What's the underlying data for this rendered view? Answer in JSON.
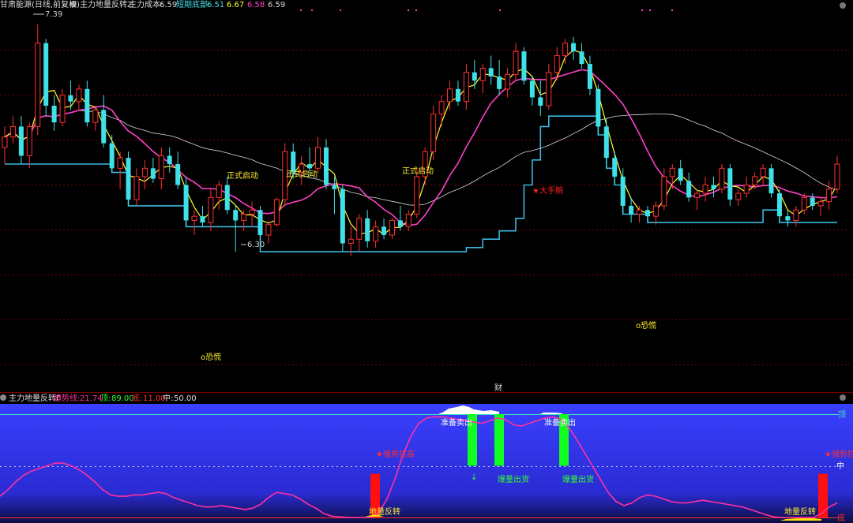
{
  "colors": {
    "candle_up": "#ff3030",
    "candle_down": "#40e0e8",
    "ma_fast": "#ffff30",
    "ma_mid": "#ff40c8",
    "ma_slow": "#d8d8d8",
    "support": "#38b8e0",
    "signal": "#ff30a0",
    "grid": "#7a0000",
    "bg_bottom": "#2b2cd8"
  },
  "top": {
    "stock": "甘肃能源(日线,前复权)",
    "indicator": "主力地量反转Z",
    "cost_label": "主力成本:",
    "cost_value": "6.59",
    "bottom_label": "短期底部:",
    "v1": "6.51",
    "v2": "6.67",
    "v3": "6.58",
    "v4": "6.59",
    "high_label": "7.39",
    "low_label": "6.30",
    "signal_start": "正式启动",
    "signal_big": "★大手腕",
    "panic": "o恐慌",
    "finance": "财"
  },
  "bottom": {
    "name": "主力地量反转F",
    "trend_label": "趋势线:",
    "trend_value": "21.74",
    "top_label": "顶:",
    "top_value": "89.00",
    "bot_label": "底:",
    "bot_value": "11.00",
    "mid_label": "中:",
    "mid_value": "50.00",
    "axis_top": "顶",
    "axis_mid": "中",
    "axis_bot": "底",
    "sell": "准备卖出",
    "reversal": "地量反转",
    "breakout": "爆量出货",
    "master": "★强势拉高"
  },
  "chart_data": [
    {
      "type": "candlestick",
      "title": "",
      "ylim": [
        6.1,
        7.45
      ],
      "high_mark": 7.39,
      "low_mark": 6.3,
      "ohlc": [
        [
          6.8,
          6.9,
          6.72,
          6.85
        ],
        [
          6.85,
          6.95,
          6.82,
          6.9
        ],
        [
          6.9,
          6.95,
          6.72,
          6.76
        ],
        [
          6.76,
          6.92,
          6.7,
          6.9
        ],
        [
          6.9,
          7.39,
          6.86,
          7.3
        ],
        [
          7.3,
          7.32,
          6.95,
          7.0
        ],
        [
          7.0,
          7.05,
          6.88,
          6.92
        ],
        [
          6.92,
          7.08,
          6.9,
          7.05
        ],
        [
          7.05,
          7.12,
          6.98,
          7.02
        ],
        [
          7.02,
          7.1,
          6.98,
          7.08
        ],
        [
          7.08,
          7.12,
          6.9,
          6.92
        ],
        [
          6.92,
          7.0,
          6.88,
          6.98
        ],
        [
          6.98,
          7.05,
          6.8,
          6.82
        ],
        [
          6.82,
          6.86,
          6.68,
          6.7
        ],
        [
          6.7,
          6.78,
          6.6,
          6.75
        ],
        [
          6.75,
          6.78,
          6.52,
          6.55
        ],
        [
          6.55,
          6.7,
          6.52,
          6.66
        ],
        [
          6.66,
          6.74,
          6.6,
          6.7
        ],
        [
          6.7,
          6.75,
          6.63,
          6.65
        ],
        [
          6.65,
          6.8,
          6.6,
          6.76
        ],
        [
          6.76,
          6.8,
          6.68,
          6.72
        ],
        [
          6.72,
          6.78,
          6.6,
          6.62
        ],
        [
          6.62,
          6.66,
          6.42,
          6.45
        ],
        [
          6.45,
          6.5,
          6.38,
          6.47
        ],
        [
          6.47,
          6.52,
          6.42,
          6.44
        ],
        [
          6.44,
          6.6,
          6.4,
          6.56
        ],
        [
          6.56,
          6.64,
          6.5,
          6.62
        ],
        [
          6.62,
          6.66,
          6.48,
          6.5
        ],
        [
          6.5,
          6.52,
          6.3,
          6.45
        ],
        [
          6.45,
          6.5,
          6.4,
          6.48
        ],
        [
          6.48,
          6.54,
          6.42,
          6.5
        ],
        [
          6.5,
          6.52,
          6.35,
          6.38
        ],
        [
          6.38,
          6.45,
          6.34,
          6.43
        ],
        [
          6.43,
          6.56,
          6.42,
          6.55
        ],
        [
          6.55,
          6.82,
          6.52,
          6.78
        ],
        [
          6.78,
          6.82,
          6.65,
          6.68
        ],
        [
          6.68,
          6.76,
          6.62,
          6.72
        ],
        [
          6.72,
          6.8,
          6.66,
          6.7
        ],
        [
          6.7,
          6.85,
          6.68,
          6.8
        ],
        [
          6.8,
          6.84,
          6.6,
          6.62
        ],
        [
          6.62,
          6.66,
          6.48,
          6.6
        ],
        [
          6.6,
          6.62,
          6.3,
          6.34
        ],
        [
          6.34,
          6.42,
          6.28,
          6.36
        ],
        [
          6.36,
          6.48,
          6.3,
          6.46
        ],
        [
          6.46,
          6.5,
          6.32,
          6.35
        ],
        [
          6.35,
          6.45,
          6.32,
          6.42
        ],
        [
          6.42,
          6.46,
          6.36,
          6.38
        ],
        [
          6.38,
          6.46,
          6.36,
          6.45
        ],
        [
          6.45,
          6.52,
          6.4,
          6.42
        ],
        [
          6.42,
          6.5,
          6.4,
          6.48
        ],
        [
          6.48,
          6.7,
          6.46,
          6.66
        ],
        [
          6.66,
          6.8,
          6.62,
          6.78
        ],
        [
          6.78,
          7.0,
          6.74,
          6.96
        ],
        [
          6.96,
          7.05,
          6.9,
          7.02
        ],
        [
          7.02,
          7.12,
          6.98,
          7.08
        ],
        [
          7.08,
          7.12,
          7.0,
          7.02
        ],
        [
          7.02,
          7.2,
          6.98,
          7.16
        ],
        [
          7.16,
          7.22,
          7.08,
          7.12
        ],
        [
          7.12,
          7.2,
          7.06,
          7.18
        ],
        [
          7.18,
          7.24,
          7.1,
          7.14
        ],
        [
          7.14,
          7.22,
          7.05,
          7.08
        ],
        [
          7.08,
          7.18,
          7.04,
          7.15
        ],
        [
          7.15,
          7.3,
          7.12,
          7.26
        ],
        [
          7.26,
          7.28,
          7.1,
          7.12
        ],
        [
          7.12,
          7.14,
          7.0,
          7.04
        ],
        [
          7.04,
          7.12,
          6.95,
          7.0
        ],
        [
          7.0,
          7.2,
          6.98,
          7.16
        ],
        [
          7.16,
          7.28,
          7.12,
          7.24
        ],
        [
          7.24,
          7.32,
          7.2,
          7.3
        ],
        [
          7.3,
          7.33,
          7.22,
          7.26
        ],
        [
          7.26,
          7.3,
          7.18,
          7.2
        ],
        [
          7.2,
          7.24,
          7.05,
          7.08
        ],
        [
          7.08,
          7.1,
          6.86,
          6.9
        ],
        [
          6.9,
          6.94,
          6.7,
          6.75
        ],
        [
          6.75,
          6.78,
          6.62,
          6.66
        ],
        [
          6.66,
          6.7,
          6.48,
          6.52
        ],
        [
          6.52,
          6.56,
          6.44,
          6.48
        ],
        [
          6.48,
          6.52,
          6.44,
          6.5
        ],
        [
          6.5,
          6.52,
          6.44,
          6.47
        ],
        [
          6.47,
          6.54,
          6.43,
          6.52
        ],
        [
          6.52,
          6.7,
          6.5,
          6.66
        ],
        [
          6.66,
          6.72,
          6.6,
          6.7
        ],
        [
          6.7,
          6.74,
          6.62,
          6.64
        ],
        [
          6.64,
          6.68,
          6.54,
          6.56
        ],
        [
          6.56,
          6.6,
          6.5,
          6.58
        ],
        [
          6.58,
          6.66,
          6.54,
          6.62
        ],
        [
          6.62,
          6.66,
          6.56,
          6.6
        ],
        [
          6.6,
          6.72,
          6.58,
          6.7
        ],
        [
          6.7,
          6.72,
          6.52,
          6.55
        ],
        [
          6.55,
          6.6,
          6.52,
          6.58
        ],
        [
          6.58,
          6.66,
          6.56,
          6.62
        ],
        [
          6.62,
          6.68,
          6.6,
          6.66
        ],
        [
          6.66,
          6.72,
          6.62,
          6.7
        ],
        [
          6.7,
          6.72,
          6.56,
          6.58
        ],
        [
          6.58,
          6.6,
          6.44,
          6.47
        ],
        [
          6.47,
          6.5,
          6.42,
          6.45
        ],
        [
          6.45,
          6.52,
          6.42,
          6.5
        ],
        [
          6.5,
          6.58,
          6.48,
          6.56
        ],
        [
          6.56,
          6.58,
          6.5,
          6.52
        ],
        [
          6.52,
          6.56,
          6.47,
          6.54
        ],
        [
          6.54,
          6.64,
          6.5,
          6.6
        ],
        [
          6.6,
          6.76,
          6.58,
          6.72
        ]
      ]
    },
    {
      "type": "line",
      "title": "",
      "ylim": [
        11,
        89
      ],
      "x": [
        0,
        10,
        20,
        30,
        40,
        50,
        60,
        70,
        80,
        90,
        100,
        110,
        120,
        130,
        140,
        150,
        160,
        170,
        180,
        190,
        200,
        210,
        220,
        230,
        240,
        250,
        260,
        270,
        280,
        290,
        300,
        310,
        320,
        330,
        340,
        350,
        360,
        370,
        380,
        390,
        400,
        410,
        420,
        430,
        440,
        450,
        460,
        470,
        480,
        490,
        500,
        510,
        520,
        530,
        540,
        550,
        560,
        570,
        580,
        590,
        600,
        610,
        620,
        630,
        640,
        650,
        660,
        670,
        680,
        690,
        700,
        710,
        720,
        730,
        740,
        750,
        760,
        770,
        780,
        790,
        800,
        810,
        820,
        830,
        840,
        850,
        860,
        870,
        880,
        890,
        900,
        910,
        920,
        930,
        940,
        950,
        960,
        970,
        980,
        990,
        1000,
        1010,
        1020,
        1030,
        1040,
        1050,
        1060
      ],
      "series": [
        {
          "values": [
            27,
            32,
            38,
            43,
            46,
            48,
            50,
            52,
            52,
            50,
            47,
            43,
            38,
            32,
            28,
            27,
            27,
            28,
            28,
            29,
            30,
            29,
            26,
            24,
            22,
            20,
            19,
            19,
            20,
            19,
            18,
            17,
            18,
            21,
            26,
            30,
            29,
            28,
            25,
            21,
            18,
            14,
            12,
            11.5,
            11,
            11,
            11,
            11,
            15,
            25,
            40,
            58,
            72,
            82,
            86,
            87,
            87,
            86,
            85,
            84,
            83,
            82,
            84,
            86,
            85,
            81,
            80,
            82,
            84,
            86,
            87,
            85,
            79,
            70,
            60,
            50,
            40,
            30,
            23,
            20,
            22,
            26,
            28,
            27,
            25,
            23,
            22,
            22,
            23,
            24,
            23,
            22,
            21,
            20,
            19,
            17,
            15,
            13,
            11.5,
            11,
            11,
            11,
            11,
            11,
            14,
            19,
            22
          ]
        }
      ],
      "bars": [
        {
          "x": 475,
          "from": 11,
          "to": 44,
          "color": "red"
        },
        {
          "x": 598,
          "from": 50,
          "to": 89,
          "color": "green"
        },
        {
          "x": 632,
          "from": 50,
          "to": 89,
          "color": "green"
        },
        {
          "x": 714,
          "from": 50,
          "to": 89,
          "color": "green"
        },
        {
          "x": 1042,
          "from": 11,
          "to": 44,
          "color": "red"
        }
      ]
    }
  ]
}
